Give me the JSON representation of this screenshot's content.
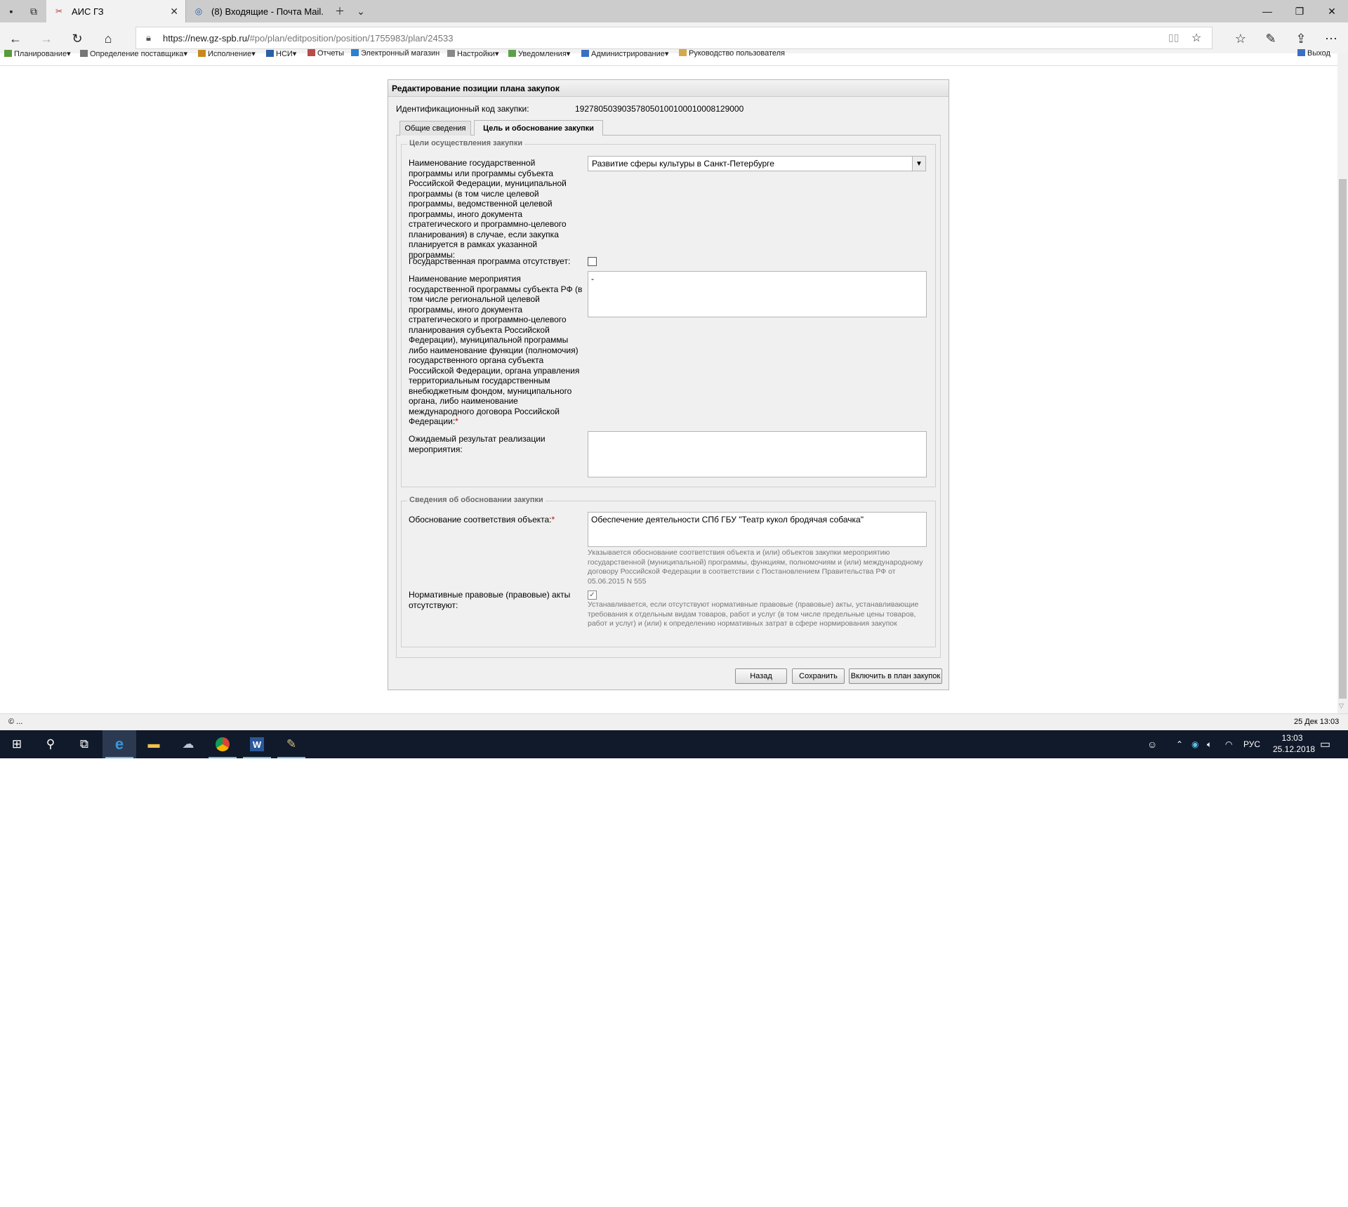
{
  "browser": {
    "tabs": [
      {
        "title": "АИС ГЗ",
        "active": true
      },
      {
        "title": "(8) Входящие - Почта Mail.",
        "active": false
      }
    ],
    "url_host": "https://new.gz-spb.ru/",
    "url_path": "#po/plan/editposition/position/1755983/plan/24533",
    "window_controls": {
      "minimize": "—",
      "maximize": "❐",
      "close": "✕"
    }
  },
  "app_menu": {
    "items": [
      "Планирование",
      "Определение поставщика",
      "Исполнение",
      "НСИ",
      "Отчеты",
      "Электронный магазин",
      "Настройки",
      "Уведомления",
      "Администрирование",
      "Руководство пользователя"
    ],
    "logout": "Выход"
  },
  "form": {
    "title": "Редактирование позиции плана закупок",
    "id_label": "Идентификационный код закупки:",
    "id_value": "192780503903578050100100010008129000",
    "tabs": [
      "Общие сведения",
      "Цель и обоснование закупки"
    ],
    "goals_legend": "Цели осуществления закупки",
    "program_label": "Наименование государственной программы или программы субъекта Российской Федерации, муниципальной программы (в том числе целевой программы, ведомственной целевой программы, иного документа стратегического и программно-целевого планирования) в случае, если закупка планируется в рамках указанной программы:",
    "program_value": "Развитие сферы культуры в Санкт-Петербурге",
    "no_program_label": "Государственная программа отсутствует:",
    "no_program_checked": false,
    "event_label": "Наименование мероприятия государственной программы субъекта РФ (в том числе региональной целевой программы, иного документа стратегического и программно-целевого планирования субъекта Российской Федерации), муниципальной программы либо наименование функции (полномочия) государственного органа субъекта Российской Федерации, органа управления территориальным государственным внебюджетным фондом, муниципального органа, либо наименование международного договора Российской Федерации:",
    "event_value": "-",
    "result_label": "Ожидаемый результат реализации мероприятия:",
    "result_value": "",
    "basis_legend": "Сведения об обосновании закупки",
    "basis_label": "Обоснование соответствия объекта:",
    "basis_value": "Обеспечение деятельности СПб ГБУ \"Театр кукол бродячая собачка\"",
    "basis_hint": "Указывается обоснование соответствия объекта и (или) объектов закупки мероприятию государственной (муниципальной) программы, функциям, полномочиям и (или) международному договору Российской Федерации в соответствии с Постановлением Правительства РФ от 05.06.2015 N 555",
    "acts_label": "Нормативные правовые (правовые) акты отсутствуют:",
    "acts_checked": true,
    "acts_hint": "Устанавливается, если отсутствуют нормативные правовые (правовые) акты, устанавливающие требования к отдельным видам товаров, работ и услуг (в том числе предельные цены товаров, работ и услуг) и (или) к определению нормативных затрат в сфере нормирования закупок",
    "required_mark": "*",
    "buttons": {
      "back": "Назад",
      "save": "Сохранить",
      "include": "Включить в план закупок"
    }
  },
  "status": {
    "left": "© ...",
    "right": "25 Дек 13:03"
  },
  "taskbar": {
    "lang": "РУС",
    "time": "13:03",
    "date": "25.12.2018"
  }
}
